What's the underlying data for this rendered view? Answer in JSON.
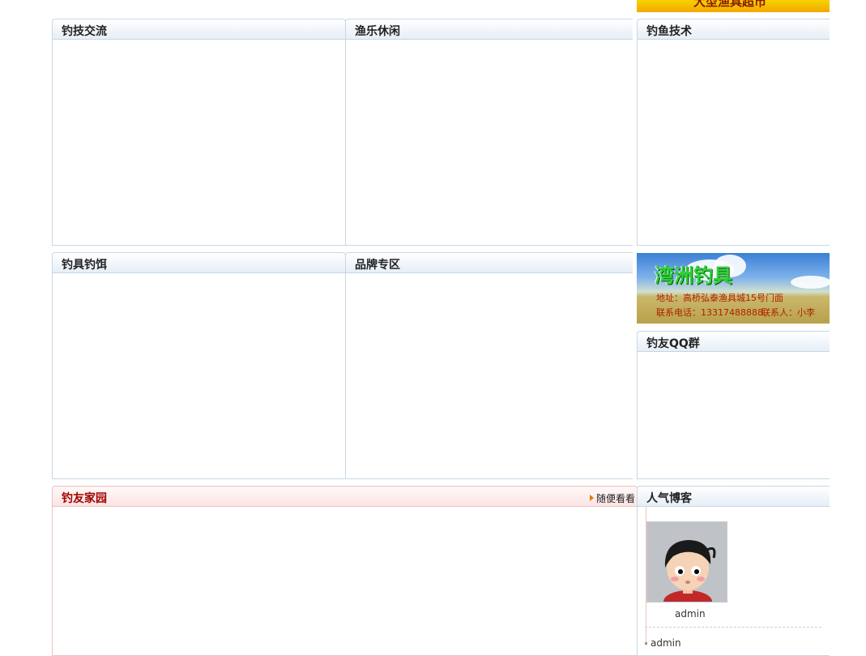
{
  "top_banner": {
    "text": "大型渔具超市"
  },
  "panels": {
    "fishing_skill_exchange": "钓技交流",
    "fishing_leisure": "渔乐休闲",
    "fishing_technique": "钓鱼技术",
    "tackle_bait": "钓具钓饵",
    "brand_zone": "品牌专区",
    "qq_group": "钓友QQ群",
    "friends_home": {
      "title": "钓友家园",
      "more": "随便看看"
    },
    "popular_blogger": {
      "title": "人气博客",
      "user_name": "admin",
      "list_item": "admin"
    }
  },
  "ad": {
    "title": "湾洲钓具",
    "address": "地址：高桥弘泰渔具城15号门面",
    "phone": "联系电话：13317488888",
    "contact": "联系人：小李"
  },
  "colors": {
    "panel_border": "#c7d7e6",
    "header_gradient_end": "#e6eef7",
    "red_title": "#a10000"
  }
}
